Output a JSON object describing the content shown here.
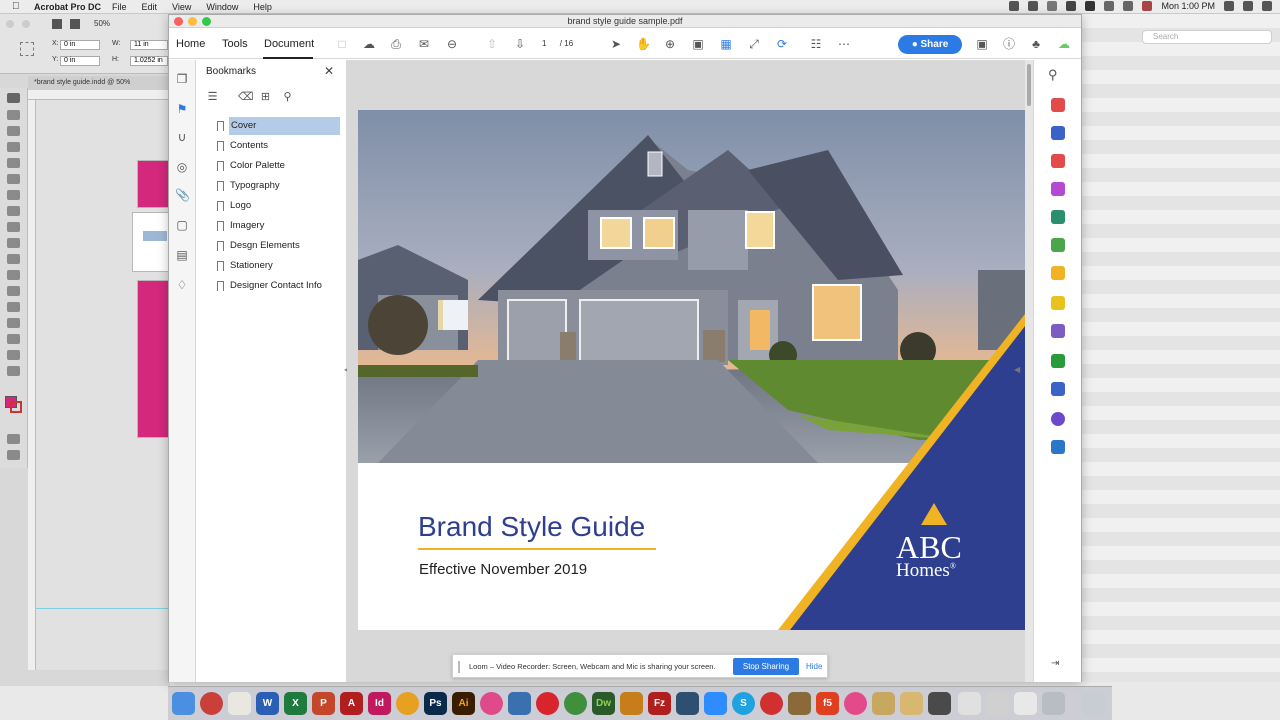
{
  "menubar": {
    "app_name": "Acrobat Pro DC",
    "menus": [
      "File",
      "Edit",
      "View",
      "Window",
      "Help"
    ],
    "clock": "Mon 1:00 PM"
  },
  "indesign": {
    "zoom": "50%",
    "doc_tab": "*brand style guide.indd @ 50%",
    "x_field": "0 in",
    "y_field": "0 in",
    "w_field": "11 in",
    "h_field": "1.0252 in"
  },
  "acrobat": {
    "doc_title": "brand style guide sample.pdf",
    "nav_tabs": {
      "home": "Home",
      "tools": "Tools",
      "document": "Document"
    },
    "page_current": "1",
    "page_total": "/ 16",
    "share_label": "Share",
    "bookmarks": {
      "title": "Bookmarks",
      "items": [
        {
          "label": "Cover"
        },
        {
          "label": "Contents"
        },
        {
          "label": "Color Palette"
        },
        {
          "label": "Typography"
        },
        {
          "label": "Logo"
        },
        {
          "label": "Imagery"
        },
        {
          "label": "Desgn Elements"
        },
        {
          "label": "Stationery"
        },
        {
          "label": "Designer Contact Info"
        }
      ]
    },
    "page": {
      "heading": "Brand Style Guide",
      "subheading": "Effective November 2019",
      "logo_line1": "ABC",
      "logo_line2": "Homes",
      "logo_reg": "®",
      "brand_blue": "#2e3f8f",
      "brand_gold": "#f0b323"
    }
  },
  "right_app": {
    "search_placeholder": "Search"
  },
  "loom": {
    "message": "Loom – Video Recorder: Screen, Webcam and Mic is sharing your screen.",
    "stop_label": "Stop Sharing",
    "hide_label": "Hide"
  }
}
